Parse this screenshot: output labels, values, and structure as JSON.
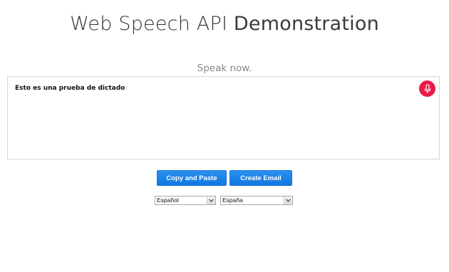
{
  "header": {
    "title_part1": "Web Speech API",
    "title_part2": "Demonstration"
  },
  "status": {
    "text": "Speak now."
  },
  "results": {
    "transcript": "Esto es una prueba de dictado",
    "mic_icon": "microphone-icon",
    "mic_color": "#ea1c4a"
  },
  "buttons": {
    "copy_label": "Copy and Paste",
    "email_label": "Create Email",
    "color": "#1a7fe8"
  },
  "selects": {
    "language": "Español",
    "dialect": "España"
  }
}
